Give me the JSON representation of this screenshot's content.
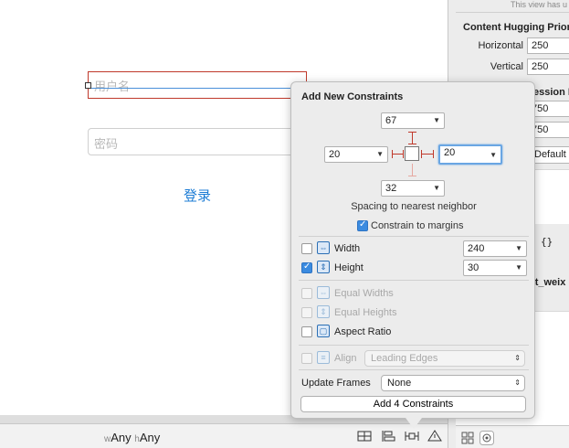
{
  "canvas": {
    "username_placeholder": "用户名",
    "password_placeholder": "密码",
    "login_label": "登录"
  },
  "bottom_bar": {
    "size_w_prefix": "w",
    "size_w_value": "Any",
    "size_h_prefix": "h",
    "size_h_value": "Any"
  },
  "inspector": {
    "top_text": "This view has u",
    "hugging_title": "Content Hugging Priori",
    "horizontal_label": "Horizontal",
    "horizontal_value": "250",
    "vertical_label": "Vertical",
    "vertical_value": "250",
    "compression_title": "ession R",
    "compression_h_value": "750",
    "compression_v_value": "750",
    "default_label": "Default",
    "braces": "{}",
    "name_text": "nt_weix"
  },
  "popover": {
    "title": "Add New Constraints",
    "top_value": "67",
    "left_value": "20",
    "right_value": "20",
    "bottom_value": "32",
    "spacing_label": "Spacing to nearest neighbor",
    "constrain_margins_label": "Constrain to margins",
    "constrain_margins_checked": true,
    "width_label": "Width",
    "width_checked": false,
    "width_value": "240",
    "height_label": "Height",
    "height_checked": true,
    "height_value": "30",
    "equal_widths_label": "Equal Widths",
    "equal_heights_label": "Equal Heights",
    "aspect_ratio_label": "Aspect Ratio",
    "align_label": "Align",
    "align_value": "Leading Edges",
    "update_frames_label": "Update Frames",
    "update_frames_value": "None",
    "add_button_label": "Add 4 Constraints"
  },
  "colors": {
    "accent": "#3b8be0",
    "strut": "#c0392b",
    "link": "#1c7cd5"
  }
}
